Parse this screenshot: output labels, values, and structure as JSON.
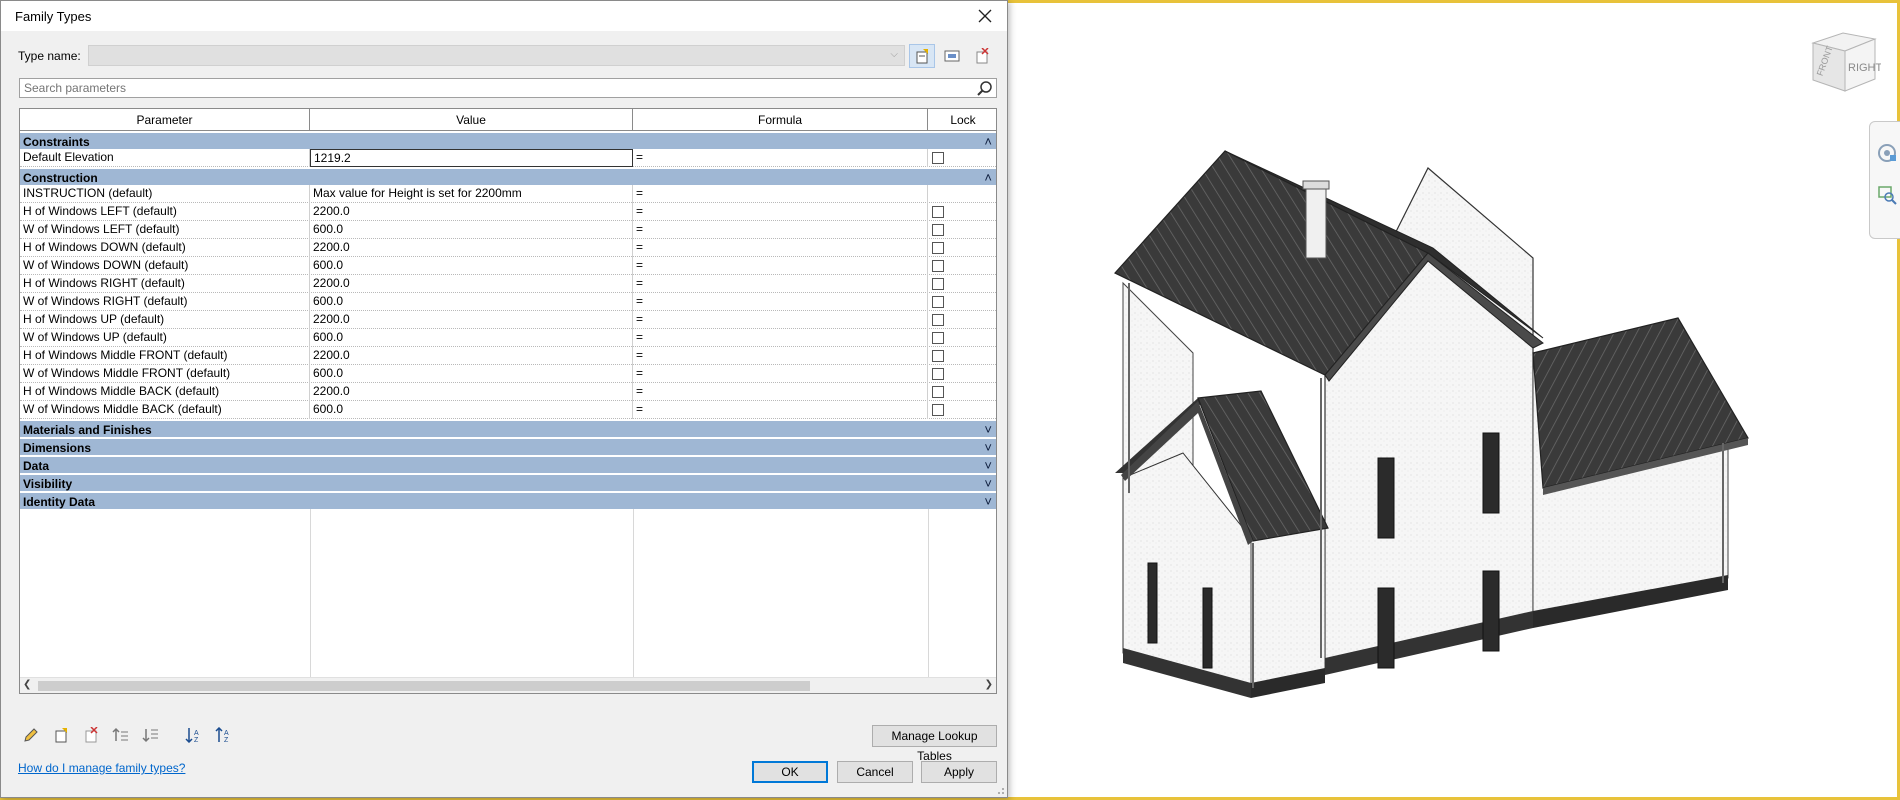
{
  "window": {
    "title": "Family Types"
  },
  "type_name": {
    "label": "Type name:",
    "value": ""
  },
  "search": {
    "placeholder": "Search parameters"
  },
  "table": {
    "headers": {
      "parameter": "Parameter",
      "value": "Value",
      "formula": "Formula",
      "lock": "Lock"
    },
    "groups": [
      {
        "name": "Constraints",
        "expanded": true,
        "rows": [
          {
            "parameter": "Default Elevation",
            "value": "1219.2",
            "formula": "=",
            "lock": false,
            "editing": true
          }
        ]
      },
      {
        "name": "Construction",
        "expanded": true,
        "rows": [
          {
            "parameter": "INSTRUCTION (default)",
            "value": "Max value for Height is set for 2200mm",
            "formula": "=",
            "lock": null
          },
          {
            "parameter": "H of Windows LEFT (default)",
            "value": "2200.0",
            "formula": "=",
            "lock": false
          },
          {
            "parameter": "W of Windows LEFT (default)",
            "value": "600.0",
            "formula": "=",
            "lock": false
          },
          {
            "parameter": "H of Windows DOWN (default)",
            "value": "2200.0",
            "formula": "=",
            "lock": false
          },
          {
            "parameter": "W of Windows DOWN (default)",
            "value": "600.0",
            "formula": "=",
            "lock": false
          },
          {
            "parameter": "H of Windows RIGHT (default)",
            "value": "2200.0",
            "formula": "=",
            "lock": false
          },
          {
            "parameter": "W of Windows RIGHT (default)",
            "value": "600.0",
            "formula": "=",
            "lock": false
          },
          {
            "parameter": "H of Windows  UP (default)",
            "value": "2200.0",
            "formula": "=",
            "lock": false
          },
          {
            "parameter": "W of Windows UP (default)",
            "value": "600.0",
            "formula": "=",
            "lock": false
          },
          {
            "parameter": "H of Windows Middle FRONT (default)",
            "value": "2200.0",
            "formula": "=",
            "lock": false
          },
          {
            "parameter": "W of Windows Middle FRONT (default)",
            "value": "600.0",
            "formula": "=",
            "lock": false
          },
          {
            "parameter": "H of Windows Middle BACK (default)",
            "value": "2200.0",
            "formula": "=",
            "lock": false
          },
          {
            "parameter": "W of Windows Middle BACK (default)",
            "value": "600.0",
            "formula": "=",
            "lock": false
          }
        ]
      },
      {
        "name": "Materials and Finishes",
        "expanded": false,
        "rows": []
      },
      {
        "name": "Dimensions",
        "expanded": false,
        "rows": []
      },
      {
        "name": "Data",
        "expanded": false,
        "rows": []
      },
      {
        "name": "Visibility",
        "expanded": false,
        "rows": []
      },
      {
        "name": "Identity Data",
        "expanded": false,
        "rows": []
      }
    ]
  },
  "buttons": {
    "manage_lookup": "Manage Lookup Tables",
    "ok": "OK",
    "cancel": "Cancel",
    "apply": "Apply"
  },
  "help_link": "How do I manage family types?",
  "viewcube": {
    "front": "FRONT",
    "right": "RIGHT"
  },
  "colors": {
    "group_header": "#9fb7d4",
    "viewport_border": "#e8c23a",
    "link": "#0066cc"
  }
}
